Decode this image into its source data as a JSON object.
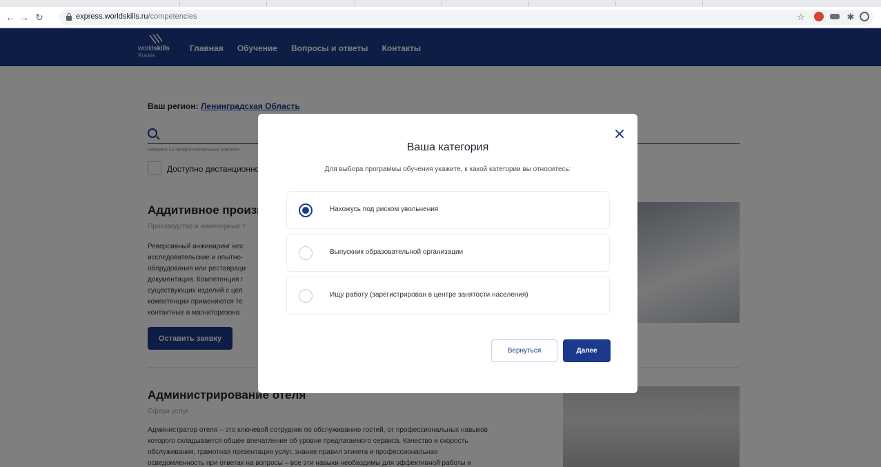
{
  "browser": {
    "url_host": "express.worldskills.ru",
    "url_path": "/competencies"
  },
  "header": {
    "logo_word_light": "world",
    "logo_word_bold": "skills",
    "logo_sub": "Russia",
    "nav": [
      "Главная",
      "Обучение",
      "Вопросы и ответы",
      "Контакты"
    ]
  },
  "filters": {
    "region_label": "Ваш регион:",
    "region_value": "Ленинградская Область",
    "found_text": "Найдено 23 профессиональные компете",
    "remote_label": "Доступно дистанционное"
  },
  "cards": [
    {
      "title": "Аддитивное произв",
      "category": "Производство и инженерные т",
      "description": [
        "Реверсивный инжиниринг нес",
        "исследовательские и опытно-",
        "оборудования или реставраци",
        "документация. Компетенция г",
        "существующих изделий с цел",
        "компетенции применяются те",
        "контактные и магниторезона"
      ],
      "apply_label": "Оставить заявку"
    },
    {
      "title": "Администрирование отеля",
      "category": "Сфера услуг",
      "description": [
        "Администратор отеля – это ключевой сотрудник по обслуживанию гостей, от профессиональных навыков",
        "которого складывается общее впечатление об уровне предлагаемого сервиса. Качество и скорость",
        "обслуживания, грамотная презентация услуг, знание правил этикета и профессиональная",
        "осведомленность при ответах на вопросы – все эти навыки необходимы для эффективной работы и"
      ]
    }
  ],
  "modal": {
    "title": "Ваша категория",
    "subtitle": "Для выбора программы обучения укажите, к какой категории вы относитесь:",
    "options": [
      {
        "label": "Нахожусь под риском увольнения",
        "selected": true
      },
      {
        "label": "Выпускник образовательной организации",
        "selected": false
      },
      {
        "label": "Ищу работу (зарегистрирован в центре занятости населения)",
        "selected": false
      }
    ],
    "back_label": "Вернуться",
    "next_label": "Далее"
  },
  "colors": {
    "brand": "#1b3a8c",
    "overlay": "rgba(0,0,0,0.5)"
  }
}
